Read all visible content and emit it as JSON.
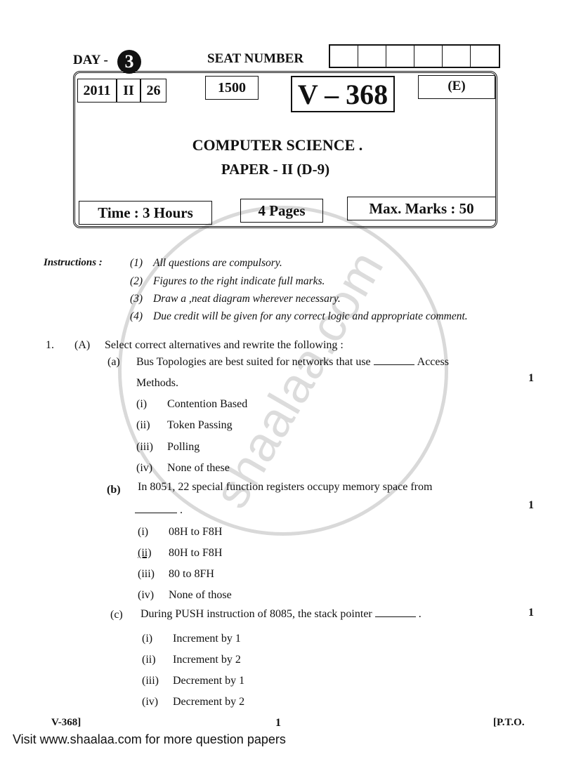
{
  "header": {
    "day_label": "DAY -",
    "day_number": "3",
    "seat_number_label": "SEAT NUMBER",
    "seat_boxes_count": 6,
    "year": "2011",
    "term": "II",
    "date": "26",
    "copies": "1500",
    "paper_code": "V – 368",
    "language": "(E)",
    "subject": "COMPUTER SCIENCE .",
    "paper": "PAPER - II (D-9)",
    "time": "Time : 3 Hours",
    "pages": "4 Pages",
    "max_marks": "Max. Marks : 50"
  },
  "instructions": {
    "label": "Instructions :",
    "items": [
      {
        "num": "(1)",
        "text": "All questions are compulsory."
      },
      {
        "num": "(2)",
        "text": "Figures to the right indicate full marks."
      },
      {
        "num": "(3)",
        "text": "Draw a ,neat diagram wherever necessary."
      },
      {
        "num": "(4)",
        "text": "Due credit will be given for any correct logic and appropriate comment."
      }
    ]
  },
  "question": {
    "number": "1.",
    "section": "(A)",
    "section_text": "Select correct alternatives and rewrite the following :",
    "subquestions": [
      {
        "label": "(a)",
        "text_before": "Bus Topologies are best suited for networks that use",
        "text_after": "Access",
        "text_line2": "Methods.",
        "marks": "1",
        "options": [
          {
            "label": "(i)",
            "text": "Contention Based"
          },
          {
            "label": "(ii)",
            "text": "Token Passing"
          },
          {
            "label": "(iii)",
            "text": "Polling"
          },
          {
            "label": "(iv)",
            "text": "None of these"
          }
        ]
      },
      {
        "label": "(b)",
        "text_before": "In 8051, 22 special function registers occupy memory space from",
        "text_line2": ".",
        "marks": "1",
        "options": [
          {
            "label": "(i)",
            "text": "08H to F8H"
          },
          {
            "label": "(ii)",
            "text": "80H to F8H",
            "underlined": true
          },
          {
            "label": "(iii)",
            "text": "80 to 8FH"
          },
          {
            "label": "(iv)",
            "text": "None of those"
          }
        ]
      },
      {
        "label": "(c)",
        "text_before": "During PUSH instruction of 8085, the stack pointer",
        "text_after": ".",
        "marks": "1",
        "options": [
          {
            "label": "(i)",
            "text": "Increment by 1"
          },
          {
            "label": "(ii)",
            "text": "Increment by 2"
          },
          {
            "label": "(iii)",
            "text": "Decrement by 1"
          },
          {
            "label": "(iv)",
            "text": "Decrement by 2"
          }
        ]
      }
    ]
  },
  "footer": {
    "paper_code": "V-368]",
    "page_number": "1",
    "pto": "[P.T.O."
  },
  "watermark": {
    "text": "shaalaa.com",
    "color": "#d9d9d9"
  },
  "visit_banner": "Visit www.shaalaa.com for more question papers"
}
